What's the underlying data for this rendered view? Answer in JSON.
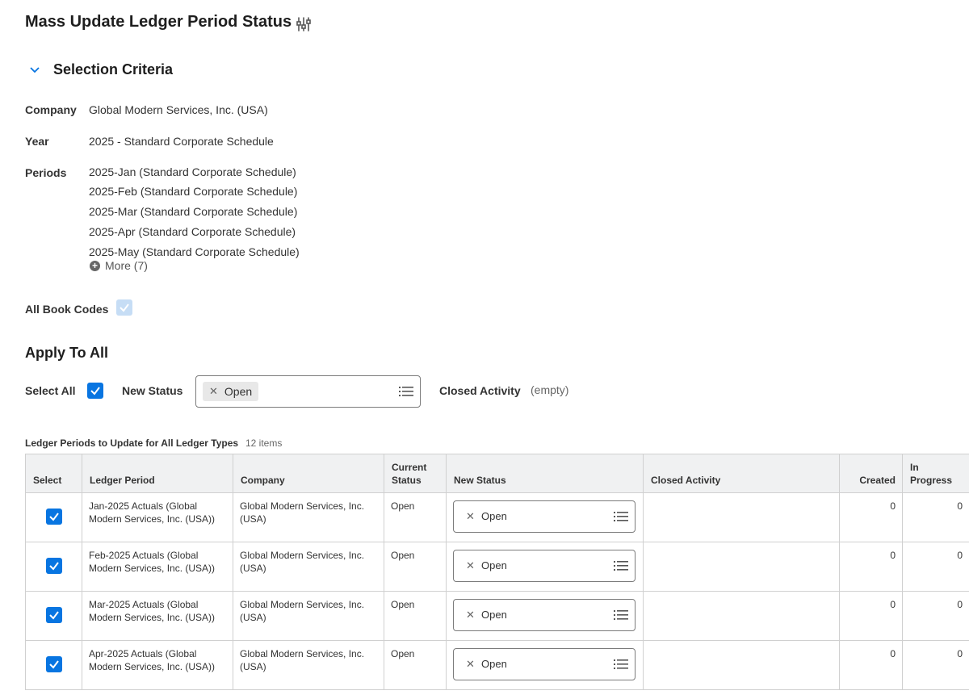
{
  "page": {
    "title": "Mass Update Ledger Period Status",
    "title_icon": "settings-sliders-icon"
  },
  "selection_criteria": {
    "heading": "Selection Criteria",
    "company_label": "Company",
    "company_value": "Global Modern Services, Inc. (USA)",
    "year_label": "Year",
    "year_value": "2025 - Standard Corporate Schedule",
    "periods_label": "Periods",
    "periods": [
      "2025-Jan (Standard Corporate Schedule)",
      "2025-Feb (Standard Corporate Schedule)",
      "2025-Mar (Standard Corporate Schedule)",
      "2025-Apr (Standard Corporate Schedule)",
      "2025-May (Standard Corporate Schedule)"
    ],
    "more_label": "More (7)",
    "all_book_codes_label": "All Book Codes"
  },
  "apply_to_all": {
    "heading": "Apply To All",
    "select_all_label": "Select All",
    "new_status_label": "New Status",
    "new_status_value": "Open",
    "closed_activity_label": "Closed Activity",
    "closed_activity_value": "(empty)"
  },
  "grid": {
    "title": "Ledger Periods to Update for All Ledger Types",
    "count": "12 items",
    "headers": {
      "select": "Select",
      "ledger_period": "Ledger Period",
      "company": "Company",
      "current_status": "Current Status",
      "new_status": "New Status",
      "closed_activity": "Closed Activity",
      "created": "Created",
      "in_progress": "In Progress"
    },
    "rows": [
      {
        "ledger_period": "Jan-2025 Actuals (Global Modern Services, Inc. (USA))",
        "company": "Global Modern Services, Inc. (USA)",
        "current_status": "Open",
        "new_status": "Open",
        "closed_activity": "",
        "created": "0",
        "in_progress": "0"
      },
      {
        "ledger_period": "Feb-2025 Actuals (Global Modern Services, Inc. (USA))",
        "company": "Global Modern Services, Inc. (USA)",
        "current_status": "Open",
        "new_status": "Open",
        "closed_activity": "",
        "created": "0",
        "in_progress": "0"
      },
      {
        "ledger_period": "Mar-2025 Actuals (Global Modern Services, Inc. (USA))",
        "company": "Global Modern Services, Inc. (USA)",
        "current_status": "Open",
        "new_status": "Open",
        "closed_activity": "",
        "created": "0",
        "in_progress": "0"
      },
      {
        "ledger_period": "Apr-2025 Actuals (Global Modern Services, Inc. (USA))",
        "company": "Global Modern Services, Inc. (USA)",
        "current_status": "Open",
        "new_status": "Open",
        "closed_activity": "",
        "created": "0",
        "in_progress": "0"
      }
    ]
  },
  "colors": {
    "accent": "#0875e1",
    "disabled_check": "#c6ddf5",
    "header_bg": "#f0f1f2",
    "border": "#d0d0d0"
  }
}
